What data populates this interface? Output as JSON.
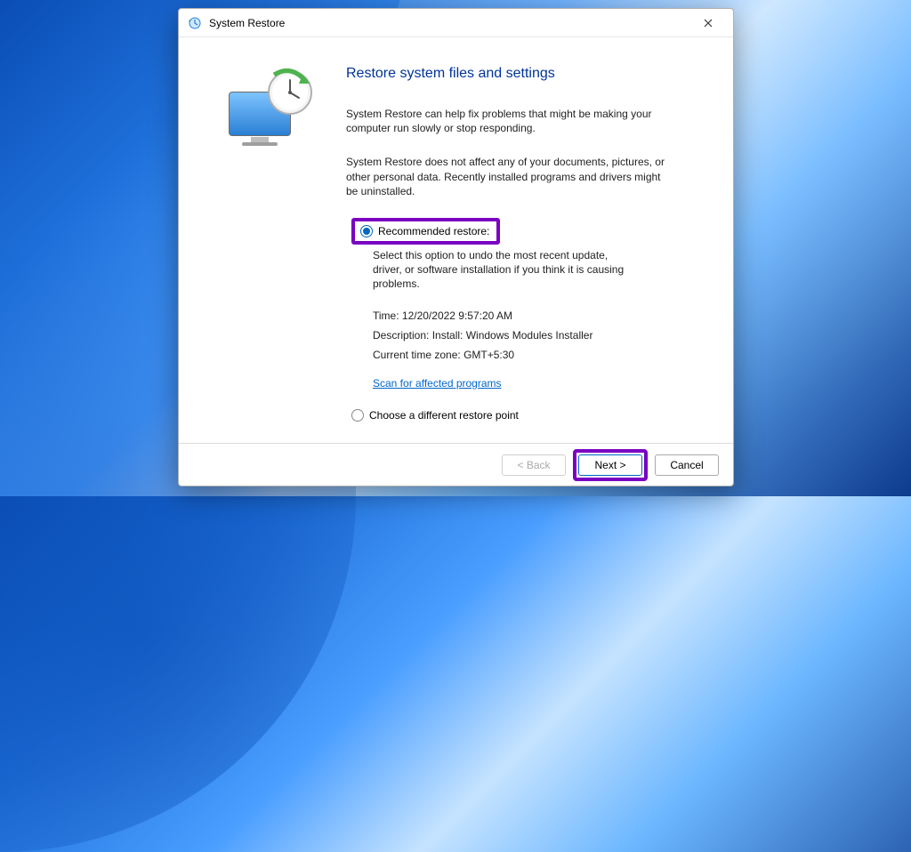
{
  "titlebar": {
    "title": "System Restore"
  },
  "main": {
    "heading": "Restore system files and settings",
    "intro1": "System Restore can help fix problems that might be making your computer run slowly or stop responding.",
    "intro2": "System Restore does not affect any of your documents, pictures, or other personal data. Recently installed programs and drivers might be uninstalled.",
    "recommended": {
      "label": "Recommended restore:",
      "subdesc": "Select this option to undo the most recent update, driver, or software installation if you think it is causing problems.",
      "time_label": "Time:",
      "time_value": "12/20/2022 9:57:20 AM",
      "desc_label": "Description:",
      "desc_value": "Install: Windows Modules Installer",
      "tz_label": "Current time zone:",
      "tz_value": "GMT+5:30",
      "scan_link": "Scan for affected programs"
    },
    "choose_different": "Choose a different restore point"
  },
  "footer": {
    "back": "< Back",
    "next": "Next >",
    "cancel": "Cancel"
  }
}
